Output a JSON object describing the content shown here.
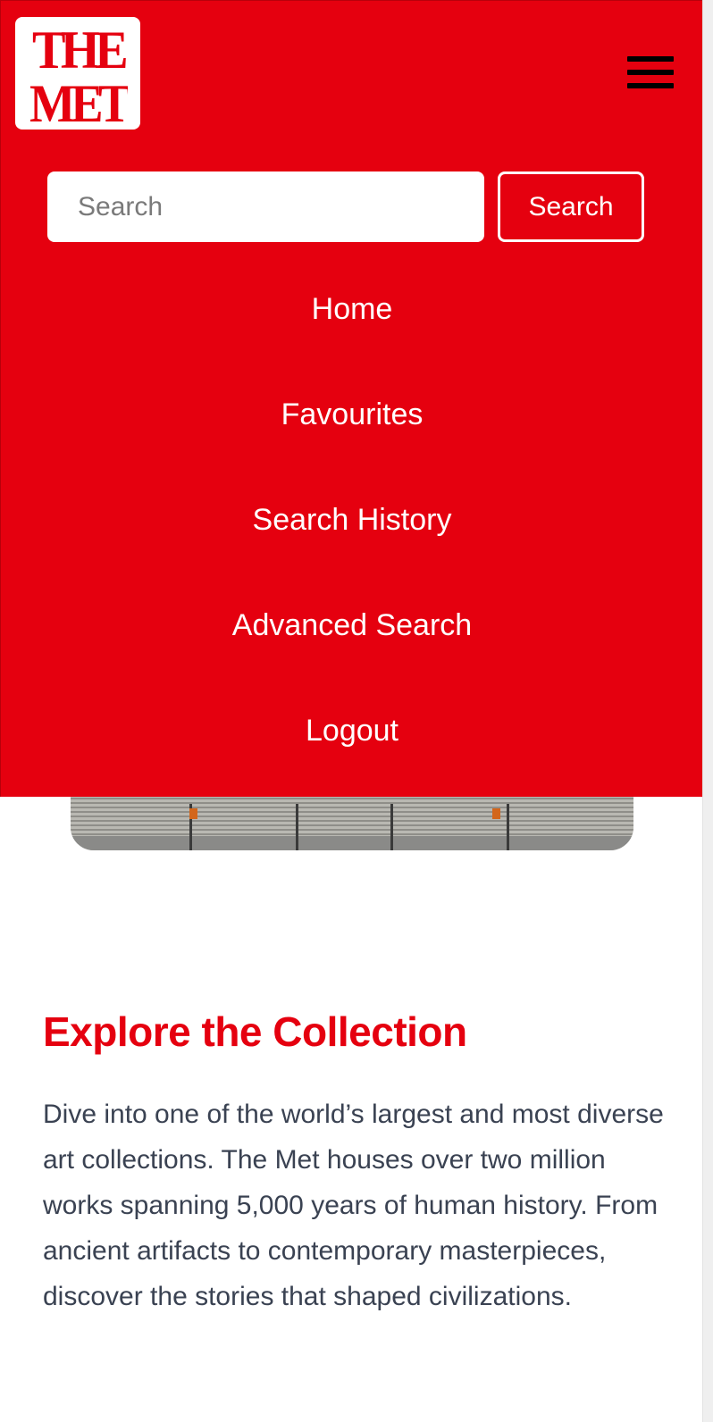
{
  "logo": {
    "line1": "THE",
    "line2": "MET",
    "color": "#e5000f"
  },
  "header": {
    "menu_icon": "hamburger-menu-icon"
  },
  "search": {
    "placeholder": "Search",
    "value": "",
    "button_label": "Search"
  },
  "nav": {
    "items": [
      {
        "label": "Home"
      },
      {
        "label": "Favourites"
      },
      {
        "label": "Search History"
      },
      {
        "label": "Advanced Search"
      },
      {
        "label": "Logout"
      }
    ]
  },
  "content": {
    "title": "Explore the Collection",
    "body": "Dive into one of the world’s largest and most diverse art collections. The Met houses over two million works spanning 5,000 years of human history. From ancient artifacts to contemporary masterpieces, discover the stories that shaped civilizations."
  },
  "colors": {
    "brand_red": "#e5000f",
    "body_text": "#3a4252",
    "white": "#ffffff"
  }
}
